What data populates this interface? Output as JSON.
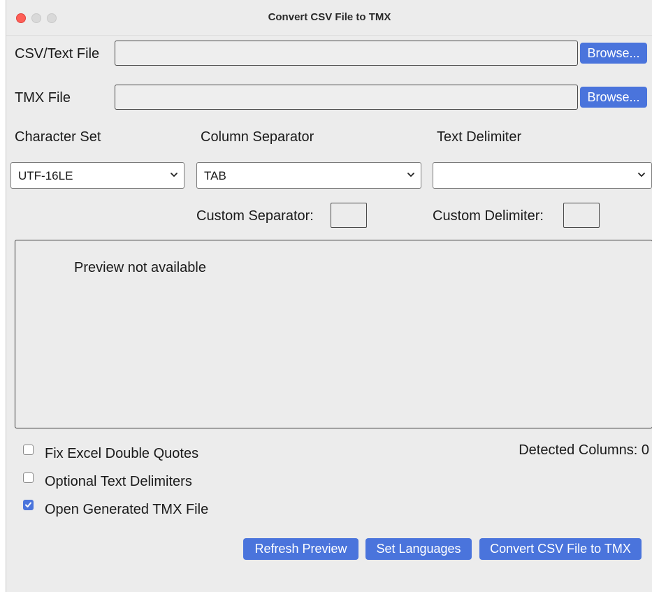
{
  "window": {
    "title": "Convert CSV File to TMX"
  },
  "csv": {
    "label": "CSV/Text File",
    "value": "",
    "browse_label": "Browse..."
  },
  "tmx": {
    "label": "TMX File",
    "value": "",
    "browse_label": "Browse..."
  },
  "charset": {
    "label": "Character Set",
    "selected": "UTF-16LE"
  },
  "separator": {
    "label": "Column Separator",
    "selected": "TAB",
    "custom_label": "Custom Separator:",
    "custom_value": ""
  },
  "delimiter": {
    "label": "Text Delimiter",
    "selected": "",
    "custom_label": "Custom Delimiter:",
    "custom_value": ""
  },
  "preview": {
    "text": "Preview not available"
  },
  "options": [
    {
      "label": "Fix Excel Double Quotes",
      "checked": false
    },
    {
      "label": "Optional Text Delimiters",
      "checked": false
    },
    {
      "label": "Open Generated TMX File",
      "checked": true
    }
  ],
  "detected": {
    "text": "Detected Columns: 0"
  },
  "buttons": {
    "refresh": "Refresh Preview",
    "languages": "Set Languages",
    "convert": "Convert CSV File to TMX"
  },
  "colors": {
    "accent": "#4a74dc",
    "close": "#fe5f57"
  }
}
